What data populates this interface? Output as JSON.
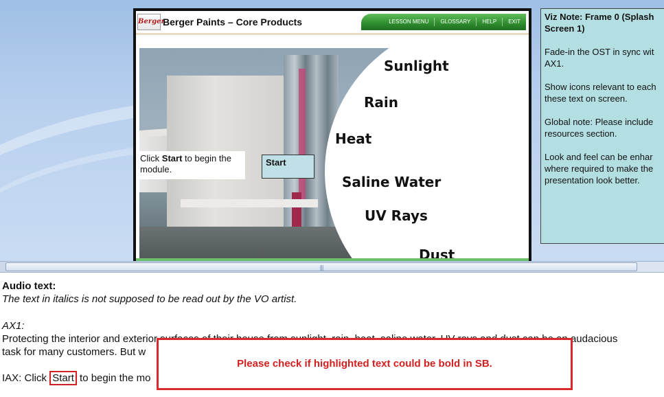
{
  "slide": {
    "course_title": "Berger Paints – Core Products",
    "logo_text": "Berger",
    "nav": [
      "LESSON MENU",
      "GLOSSARY",
      "HELP",
      "EXIT"
    ],
    "words": [
      "Sunlight",
      "Rain",
      "Heat",
      "Saline Water",
      "UV Rays",
      "Dust"
    ],
    "start_prompt_pre": "Click ",
    "start_prompt_bold": "Start",
    "start_prompt_post": " to begin the module.",
    "start_button": "Start"
  },
  "viz_note": {
    "title": "Viz Note: Frame 0 (Splash Screen 1)",
    "lines": [
      "Fade-in the OST in sync wit",
      "AX1.",
      "Show icons relevant to each",
      "these text on screen.",
      "Global note: Please include",
      "resources section.",
      "Look and feel can be enhar",
      "where required to make the",
      "presentation look better."
    ]
  },
  "notes": {
    "audio_heading": "Audio text:",
    "italic_note": "The text in italics is not supposed to be read out by the VO artist.",
    "ax1_label": "AX1:",
    "ax1_line1": "Protecting the interior and exterior surfaces of their house from sunlight, rain, heat, saline water, UV rays and dust can be an audacious",
    "ax1_line2": "task for many customers. But w",
    "iax_pre": "IAX: Click ",
    "iax_highlight": "Start",
    "iax_post": " to begin the mo"
  },
  "warning": "Please check if highlighted text could be bold in SB.",
  "colors": {
    "accent_green": "#2e8b2e",
    "note_bg": "#b3dfe3",
    "warning_red": "#d32020"
  }
}
